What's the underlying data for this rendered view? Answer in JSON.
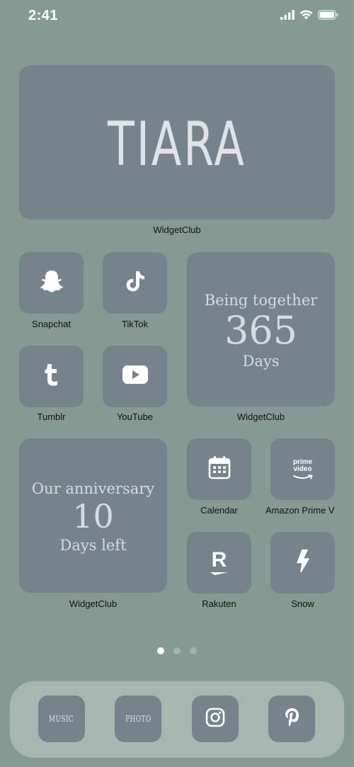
{
  "status_bar": {
    "time": "2:41"
  },
  "widget_top": {
    "text": "TIARA",
    "label": "WidgetClub"
  },
  "apps": {
    "snapchat": "Snapchat",
    "tiktok": "TikTok",
    "tumblr": "Tumblr",
    "youtube": "YouTube",
    "calendar": "Calendar",
    "amazon": "Amazon Prime V",
    "rakuten": "Rakuten",
    "snow": "Snow"
  },
  "widget_together": {
    "line1": "Being together",
    "number": "365",
    "line2": "Days",
    "label": "WidgetClub"
  },
  "widget_anniversary": {
    "line1": "Our anniversary",
    "number": "10",
    "line2": "Days left",
    "label": "WidgetClub"
  },
  "amazon_logo": {
    "line1": "prime",
    "line2": "video"
  },
  "rakuten_logo": "R",
  "page_dots": {
    "count": 3,
    "active_index": 0
  },
  "dock": {
    "music": "MUSIC",
    "photo": "PHOTO"
  },
  "colors": {
    "background": "#869a94",
    "tile": "#75848b",
    "dock": "#a8b6b2",
    "icon": "#ffffff"
  }
}
